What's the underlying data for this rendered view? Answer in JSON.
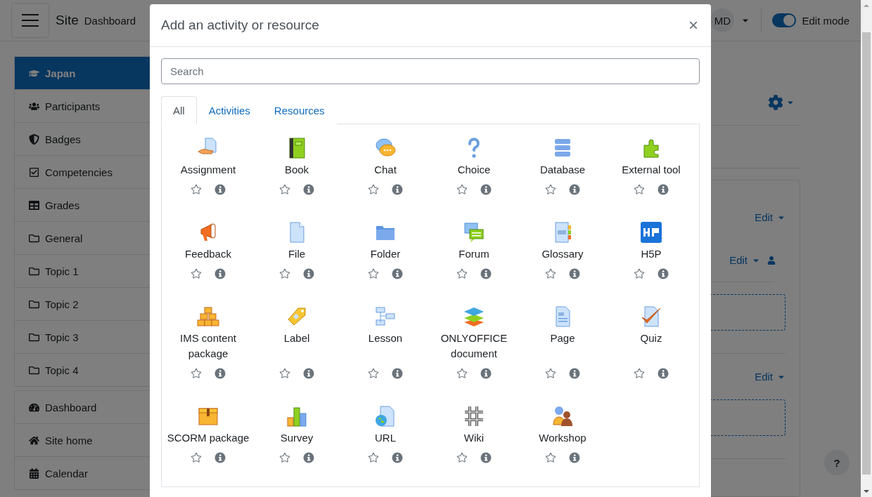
{
  "navbar": {
    "brand": "Site",
    "links": [
      "Dashboard"
    ],
    "avatar": "MD",
    "edit_mode": {
      "label": "Edit mode",
      "on": true
    }
  },
  "sidebar": {
    "sections": [
      {
        "items": [
          {
            "kind": "course",
            "label": "Japan",
            "selected": true
          },
          {
            "kind": "participants",
            "label": "Participants",
            "selected": false
          },
          {
            "kind": "badges",
            "label": "Badges",
            "selected": false
          },
          {
            "kind": "competencies",
            "label": "Competencies",
            "selected": false
          },
          {
            "kind": "grades",
            "label": "Grades",
            "selected": false
          },
          {
            "kind": "folder",
            "label": "General",
            "selected": false
          },
          {
            "kind": "folder",
            "label": "Topic 1",
            "selected": false
          },
          {
            "kind": "folder",
            "label": "Topic 2",
            "selected": false
          },
          {
            "kind": "folder",
            "label": "Topic 3",
            "selected": false
          },
          {
            "kind": "folder",
            "label": "Topic 4",
            "selected": false
          }
        ]
      },
      {
        "items": [
          {
            "kind": "dashboard",
            "label": "Dashboard",
            "selected": false
          },
          {
            "kind": "home",
            "label": "Site home",
            "selected": false
          },
          {
            "kind": "calendar",
            "label": "Calendar",
            "selected": false
          }
        ]
      }
    ]
  },
  "course": {
    "edit_links": [
      "Edit",
      "Edit",
      "Edit"
    ],
    "help": "?"
  },
  "modal": {
    "title": "Add an activity or resource",
    "close": "×",
    "search": {
      "placeholder": "Search"
    },
    "tabs": [
      {
        "label": "All",
        "selected": true
      },
      {
        "label": "Activities",
        "selected": false
      },
      {
        "label": "Resources",
        "selected": false
      }
    ],
    "items": [
      {
        "kind": "assignment",
        "label": "Assignment"
      },
      {
        "kind": "book",
        "label": "Book"
      },
      {
        "kind": "chat",
        "label": "Chat"
      },
      {
        "kind": "choice",
        "label": "Choice"
      },
      {
        "kind": "database",
        "label": "Database"
      },
      {
        "kind": "external",
        "label": "External tool"
      },
      {
        "kind": "feedback",
        "label": "Feedback"
      },
      {
        "kind": "file",
        "label": "File"
      },
      {
        "kind": "folder",
        "label": "Folder"
      },
      {
        "kind": "forum",
        "label": "Forum"
      },
      {
        "kind": "glossary",
        "label": "Glossary"
      },
      {
        "kind": "h5p",
        "label": "H5P"
      },
      {
        "kind": "ims",
        "label": "IMS content package"
      },
      {
        "kind": "label",
        "label": "Label"
      },
      {
        "kind": "lesson",
        "label": "Lesson"
      },
      {
        "kind": "onlyoffice",
        "label": "ONLYOFFICE document"
      },
      {
        "kind": "page",
        "label": "Page"
      },
      {
        "kind": "quiz",
        "label": "Quiz"
      },
      {
        "kind": "scorm",
        "label": "SCORM package"
      },
      {
        "kind": "survey",
        "label": "Survey"
      },
      {
        "kind": "url",
        "label": "URL"
      },
      {
        "kind": "wiki",
        "label": "Wiki"
      },
      {
        "kind": "workshop",
        "label": "Workshop"
      }
    ]
  }
}
